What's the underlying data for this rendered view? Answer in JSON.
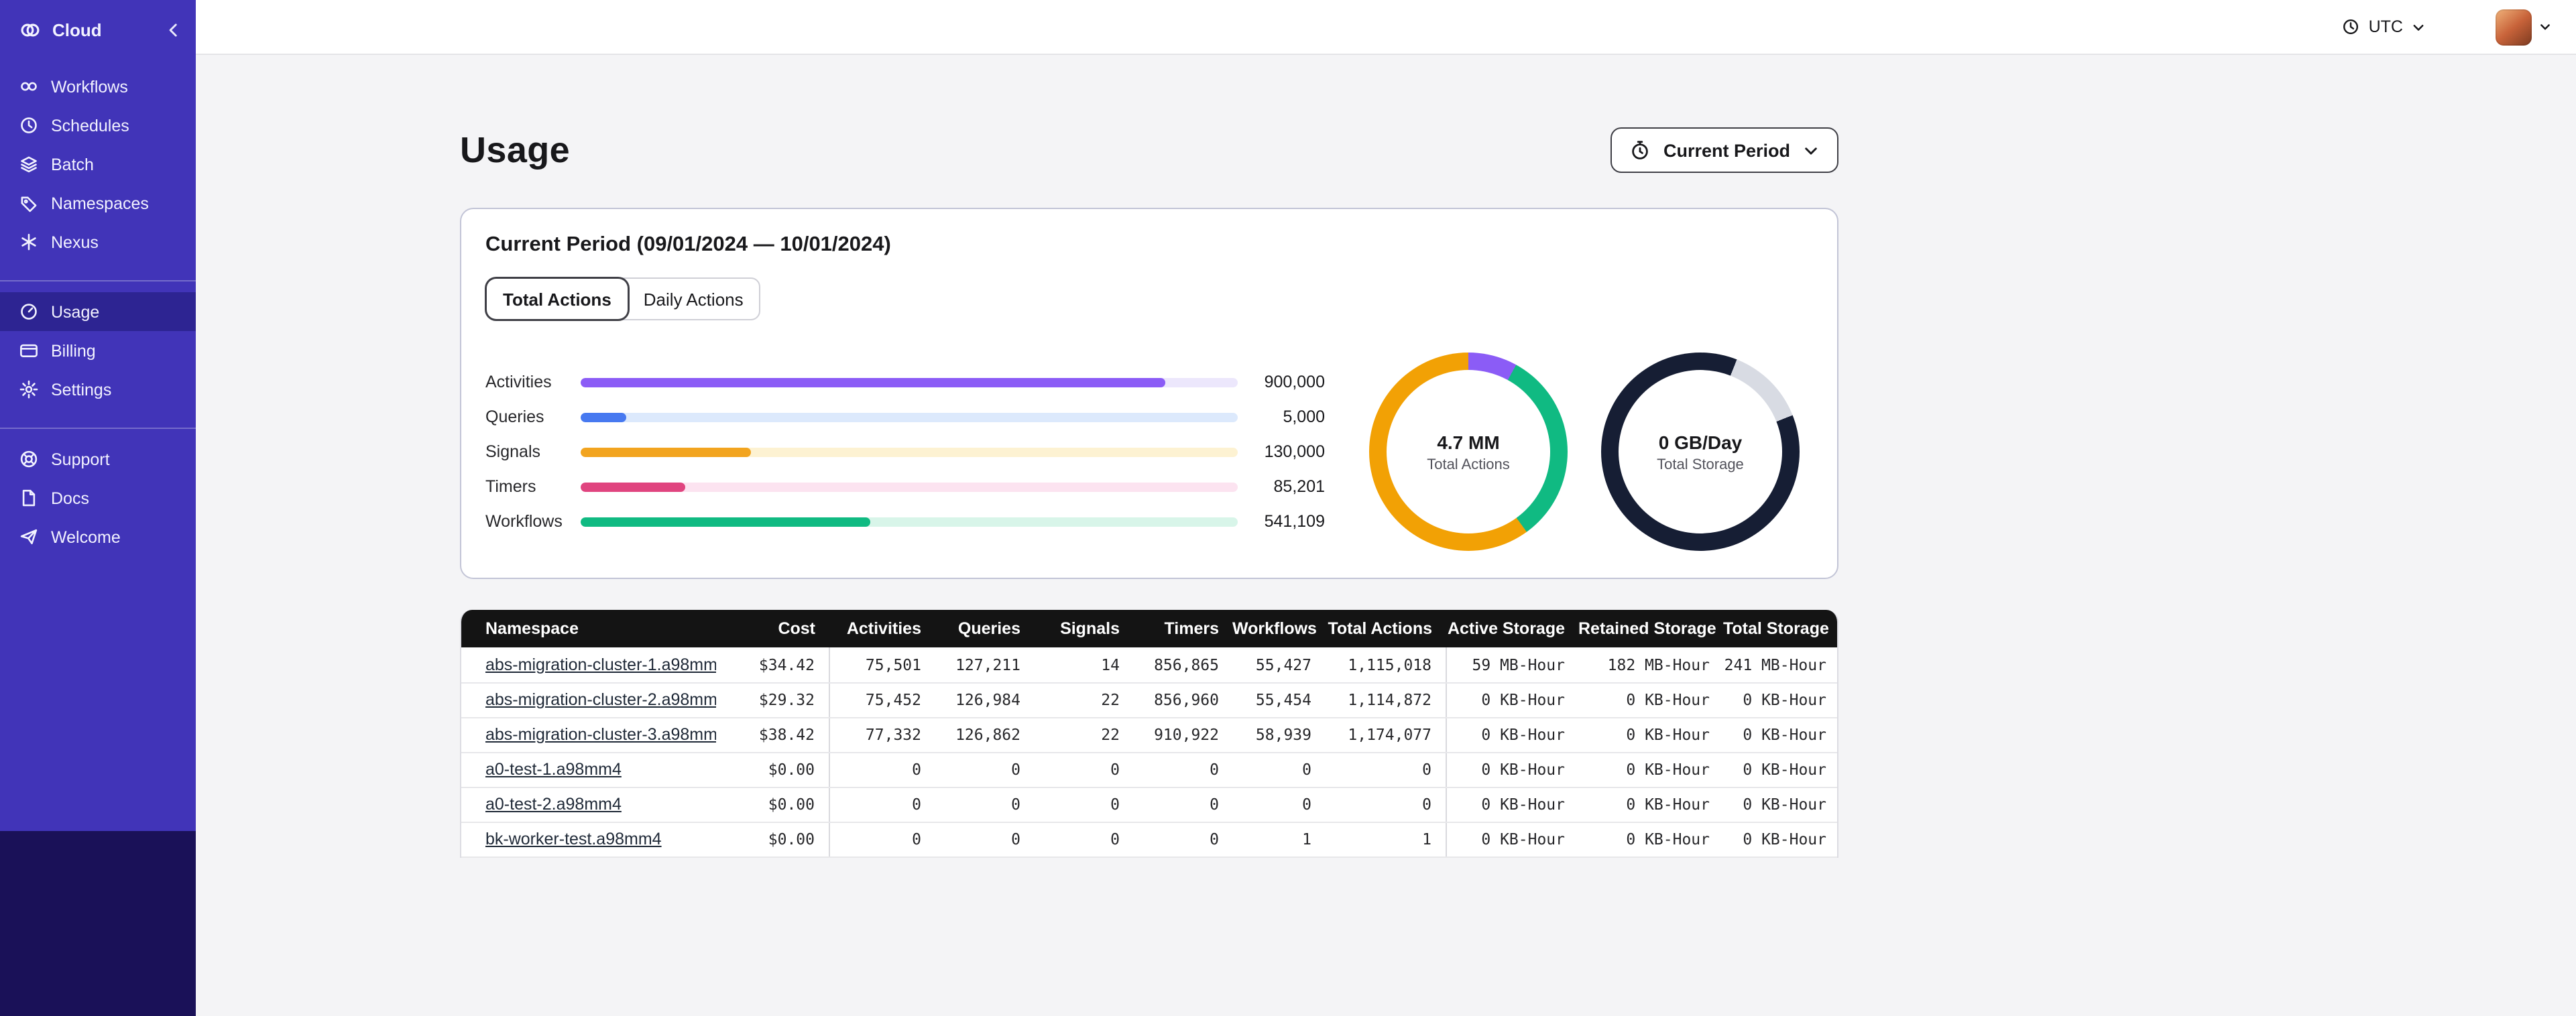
{
  "colors": {
    "sidebar_bg": "#4134b8",
    "sidebar_active_bg": "#2d2492",
    "sidebar_footer_bg": "#1a1158",
    "table_header_bg": "#141414",
    "page_bg": "#f4f4f6"
  },
  "sidebar": {
    "brand": {
      "label": "Cloud",
      "logo_icon": "temporal-cloud-logo-icon",
      "collapse_icon": "chevron-left-icon"
    },
    "groups": [
      {
        "items": [
          {
            "icon": "workflows-icon",
            "label": "Workflows"
          },
          {
            "icon": "schedules-icon",
            "label": "Schedules"
          },
          {
            "icon": "batch-icon",
            "label": "Batch"
          },
          {
            "icon": "namespaces-icon",
            "label": "Namespaces"
          },
          {
            "icon": "nexus-icon",
            "label": "Nexus"
          }
        ]
      },
      {
        "items": [
          {
            "icon": "usage-icon",
            "label": "Usage",
            "active": true
          },
          {
            "icon": "billing-icon",
            "label": "Billing"
          },
          {
            "icon": "settings-icon",
            "label": "Settings"
          }
        ]
      },
      {
        "items": [
          {
            "icon": "support-icon",
            "label": "Support"
          },
          {
            "icon": "docs-icon",
            "label": "Docs"
          },
          {
            "icon": "welcome-icon",
            "label": "Welcome"
          }
        ]
      }
    ]
  },
  "topbar": {
    "timezone": "UTC",
    "timezone_icon": "clock-icon",
    "glasses_icon": "glasses-icon",
    "avatar_icon": "user-avatar"
  },
  "page": {
    "title": "Usage",
    "period_selector_label": "Current Period",
    "period_selector_icon": "stopwatch-icon"
  },
  "usage_card": {
    "title": "Current Period (09/01/2024 — 10/01/2024)",
    "tabs": [
      {
        "label": "Total Actions",
        "active": true
      },
      {
        "label": "Daily Actions",
        "active": false
      }
    ]
  },
  "chart_data": [
    {
      "type": "bar",
      "orientation": "horizontal",
      "categories": [
        "Activities",
        "Queries",
        "Signals",
        "Timers",
        "Workflows"
      ],
      "values": [
        900000,
        5000,
        130000,
        85201,
        541109
      ],
      "value_labels": [
        "900,000",
        "5,000",
        "130,000",
        "85,201",
        "541,109"
      ],
      "fill_percents": [
        89,
        7,
        26,
        16,
        44
      ],
      "colors": [
        "#8b5cf6",
        "#4779f0",
        "#f2a41f",
        "#e0447f",
        "#10ba82"
      ],
      "track_colors": [
        "#ece7fc",
        "#dce9fc",
        "#fdf2d2",
        "#fce3f0",
        "#d8f5e9"
      ],
      "grid": false,
      "legend": false
    },
    {
      "type": "pie",
      "kind": "donut",
      "center_label": "4.7 MM",
      "center_sublabel": "Total Actions",
      "slices": [
        {
          "label": "segment-1",
          "percent": 8,
          "color": "#8b5cf6"
        },
        {
          "label": "segment-2",
          "percent": 32,
          "color": "#10ba82"
        },
        {
          "label": "segment-3",
          "percent": 60,
          "color": "#f2a105"
        }
      ]
    },
    {
      "type": "pie",
      "kind": "donut",
      "center_label": "0 GB/Day",
      "center_sublabel": "Total Storage",
      "slices": [
        {
          "label": "segment-1",
          "percent": 6,
          "color": "#161e34"
        },
        {
          "label": "segment-2",
          "percent": 13,
          "color": "#d8dbe3"
        },
        {
          "label": "segment-3",
          "percent": 81,
          "color": "#161e34"
        }
      ]
    }
  ],
  "table": {
    "columns": [
      "Namespace",
      "Cost",
      "Activities",
      "Queries",
      "Signals",
      "Timers",
      "Workflows",
      "Total Actions",
      "Active Storage",
      "Retained Storage",
      "Total Storage"
    ],
    "group_start_columns": [
      2,
      8
    ],
    "rows": [
      [
        "abs-migration-cluster-1.a98mm4",
        "$34.42",
        "75,501",
        "127,211",
        "14",
        "856,865",
        "55,427",
        "1,115,018",
        "59 MB-Hour",
        "182 MB-Hour",
        "241 MB-Hour"
      ],
      [
        "abs-migration-cluster-2.a98mm4",
        "$29.32",
        "75,452",
        "126,984",
        "22",
        "856,960",
        "55,454",
        "1,114,872",
        "0 KB-Hour",
        "0 KB-Hour",
        "0 KB-Hour"
      ],
      [
        "abs-migration-cluster-3.a98mm4",
        "$38.42",
        "77,332",
        "126,862",
        "22",
        "910,922",
        "58,939",
        "1,174,077",
        "0 KB-Hour",
        "0 KB-Hour",
        "0 KB-Hour"
      ],
      [
        "a0-test-1.a98mm4",
        "$0.00",
        "0",
        "0",
        "0",
        "0",
        "0",
        "0",
        "0 KB-Hour",
        "0 KB-Hour",
        "0 KB-Hour"
      ],
      [
        "a0-test-2.a98mm4",
        "$0.00",
        "0",
        "0",
        "0",
        "0",
        "0",
        "0",
        "0 KB-Hour",
        "0 KB-Hour",
        "0 KB-Hour"
      ],
      [
        "bk-worker-test.a98mm4",
        "$0.00",
        "0",
        "0",
        "0",
        "0",
        "1",
        "1",
        "0 KB-Hour",
        "0 KB-Hour",
        "0 KB-Hour"
      ]
    ]
  }
}
